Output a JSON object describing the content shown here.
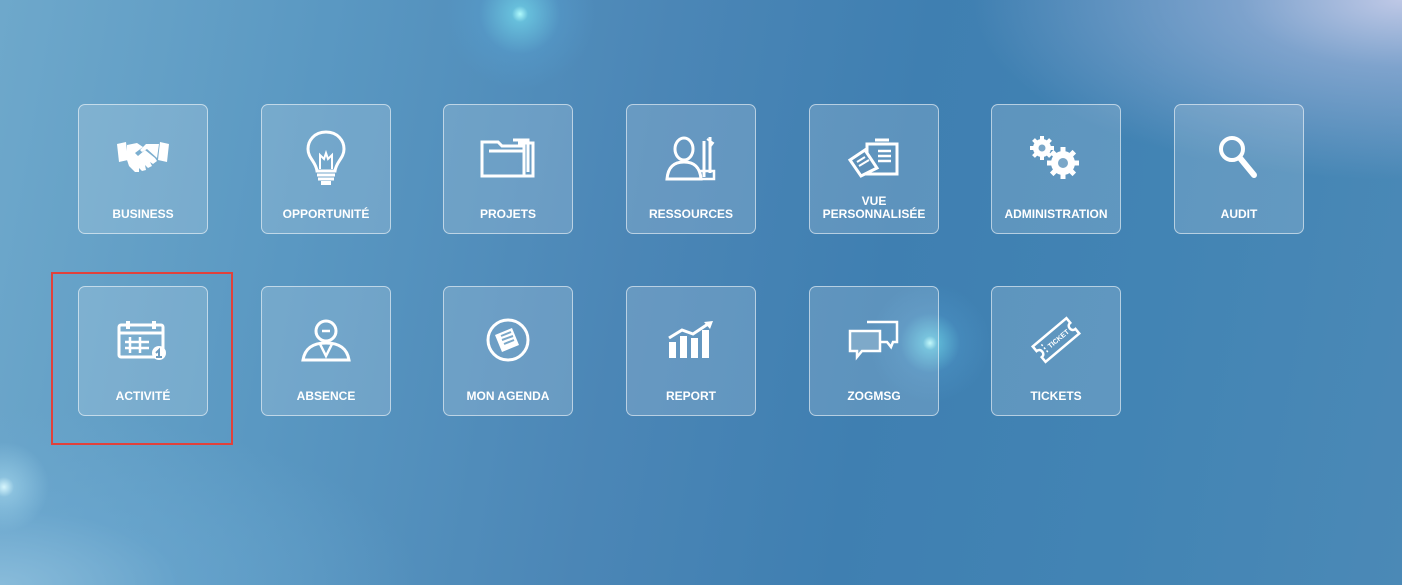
{
  "tiles": [
    {
      "label": "BUSINESS",
      "icon": "handshake-icon"
    },
    {
      "label": "OPPORTUNITÉ",
      "icon": "lightbulb-icon"
    },
    {
      "label": "PROJETS",
      "icon": "folder-icon"
    },
    {
      "label": "RESSOURCES",
      "icon": "person-tools-icon"
    },
    {
      "label": "VUE PERSONNALISÉE",
      "icon": "custom-view-icon"
    },
    {
      "label": "ADMINISTRATION",
      "icon": "gears-icon"
    },
    {
      "label": "AUDIT",
      "icon": "magnifier-icon"
    },
    {
      "label": "ACTIVITÉ",
      "icon": "calendar-icon"
    },
    {
      "label": "ABSENCE",
      "icon": "person-icon"
    },
    {
      "label": "MON AGENDA",
      "icon": "agenda-icon"
    },
    {
      "label": "REPORT",
      "icon": "bar-chart-icon"
    },
    {
      "label": "ZOGMSG",
      "icon": "chat-bubbles-icon"
    },
    {
      "label": "TICKETS",
      "icon": "ticket-icon"
    }
  ],
  "ticket_icon_text": "TICKET",
  "highlighted_tile": "ACTIVITÉ",
  "colors": {
    "highlight_border": "#e1413b",
    "tile_border": "rgba(255,255,255,0.55)",
    "text": "#ffffff"
  }
}
